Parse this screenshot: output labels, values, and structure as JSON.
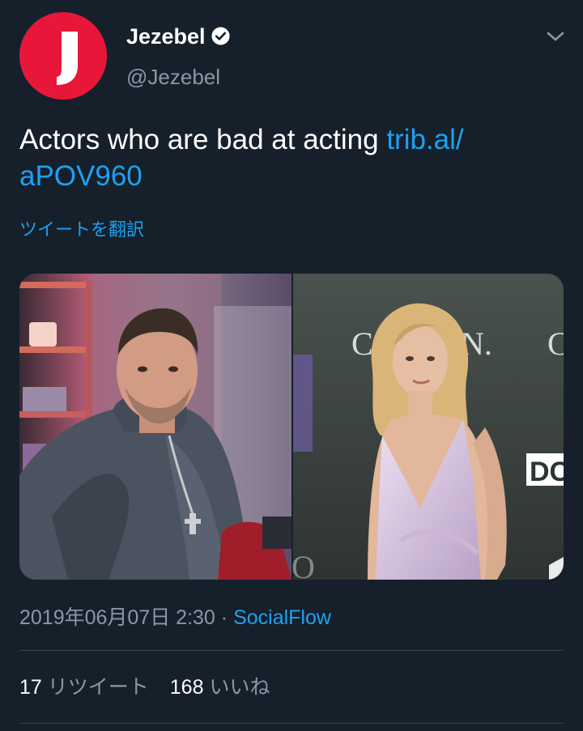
{
  "account": {
    "display_name": "Jezebel",
    "handle": "@Jezebel",
    "avatar_letter": "J",
    "avatar_color": "#e8173a",
    "verified_icon": "verified-badge-icon"
  },
  "tweet": {
    "text": "Actors who are bad at acting ",
    "link_line1": "trib.al/",
    "link_line2": "aPOV960",
    "translate_label": "ツイートを翻訳"
  },
  "media": {
    "left_photo": "man-in-hoodie-photo",
    "right_photo": "woman-in-lavender-dress-photo",
    "backdrop_letters": [
      "C",
      "N.",
      "C",
      "DC"
    ]
  },
  "meta": {
    "timestamp": "2019年06月07日 2:30",
    "separator": " · ",
    "source": "SocialFlow"
  },
  "stats": {
    "retweets_count": "17",
    "retweets_label": "リツイート",
    "likes_count": "168",
    "likes_label": "いいね"
  },
  "colors": {
    "background": "#15202b",
    "link": "#1da1f2",
    "secondary_text": "#8899a6",
    "divider": "#38444d"
  }
}
